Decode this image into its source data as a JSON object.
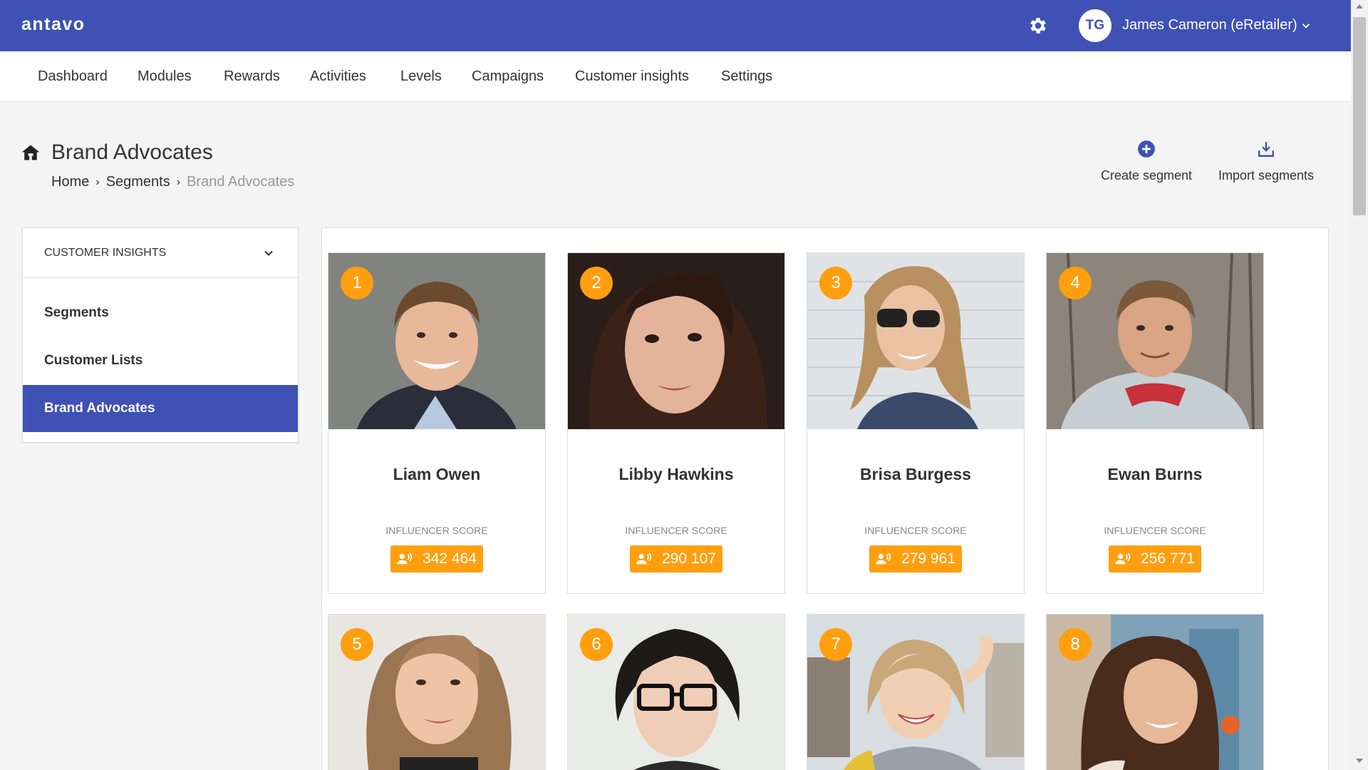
{
  "app": {
    "logo": "antavo",
    "user_initials": "TG",
    "user_name": "James Cameron (eRetailer)"
  },
  "nav": {
    "items": [
      "Dashboard",
      "Modules",
      "Rewards",
      "Activities",
      "Levels",
      "Campaigns",
      "Customer insights",
      "Settings"
    ]
  },
  "page": {
    "title": "Brand Advocates",
    "breadcrumb": [
      "Home",
      "Segments",
      "Brand Advocates"
    ]
  },
  "actions": {
    "create": "Create segment",
    "import": "Import segments"
  },
  "sidebar": {
    "header": "CUSTOMER INSIGHTS",
    "items": [
      {
        "label": "Segments",
        "active": false
      },
      {
        "label": "Customer Lists",
        "active": false
      },
      {
        "label": "Brand Advocates",
        "active": true
      }
    ]
  },
  "advocates": [
    {
      "rank": "1",
      "name": "Liam Owen",
      "score_label": "INFLUENCER SCORE",
      "score": "342 464"
    },
    {
      "rank": "2",
      "name": "Libby Hawkins",
      "score_label": "INFLUENCER SCORE",
      "score": "290 107"
    },
    {
      "rank": "3",
      "name": "Brisa Burgess",
      "score_label": "INFLUENCER SCORE",
      "score": "279 961"
    },
    {
      "rank": "4",
      "name": "Ewan Burns",
      "score_label": "INFLUENCER SCORE",
      "score": "256 771"
    },
    {
      "rank": "5"
    },
    {
      "rank": "6"
    },
    {
      "rank": "7"
    },
    {
      "rank": "8"
    }
  ],
  "colors": {
    "primary": "#3f51b5",
    "accent": "#ff9f10"
  }
}
